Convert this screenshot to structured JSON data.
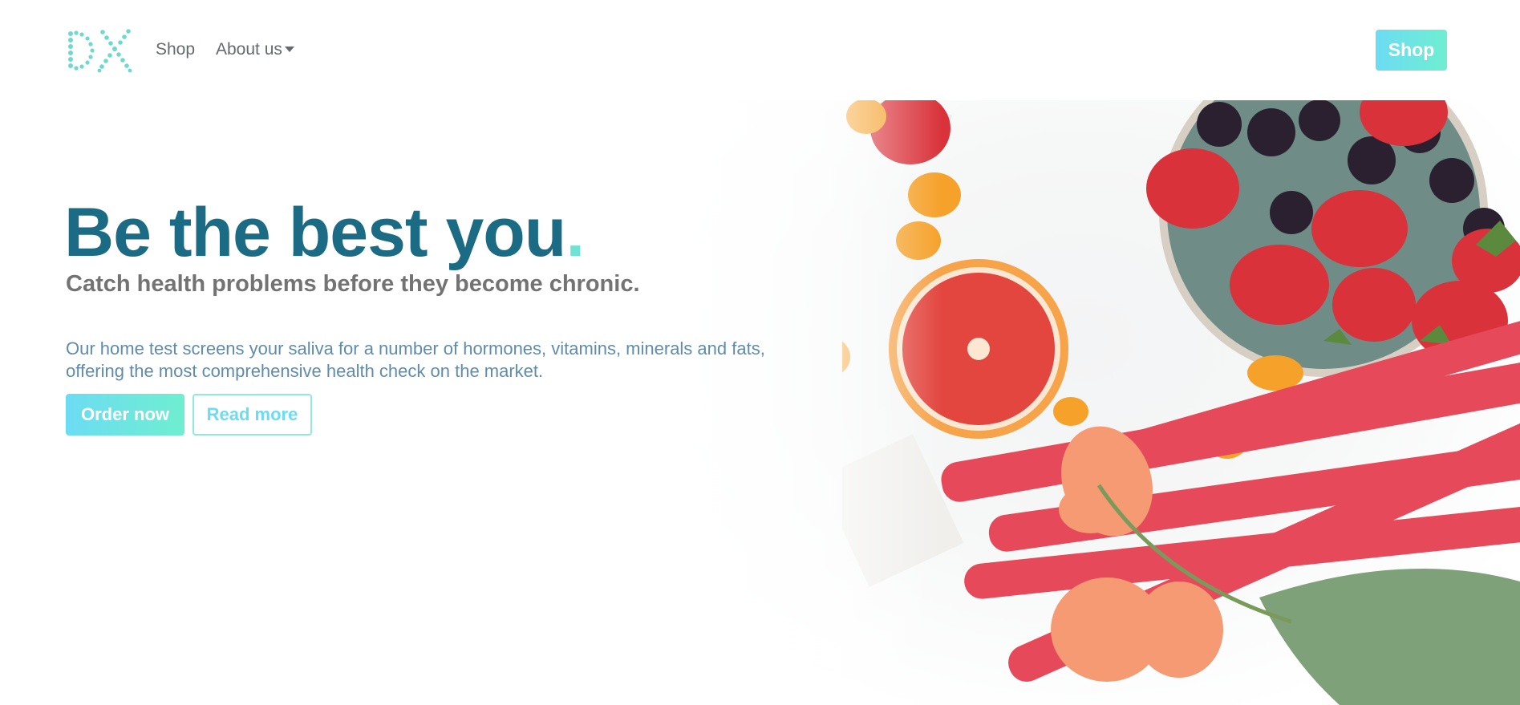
{
  "brand": {
    "logo_text": "DX",
    "logo_icon": "dx-dotted-logo-icon"
  },
  "nav": {
    "shop_label": "Shop",
    "about_label": "About us",
    "about_icon": "caret-down-icon",
    "shop_button_label": "Shop"
  },
  "hero": {
    "headline": "Be the best you",
    "headline_dot": ".",
    "subheadline": "Catch health problems before they become chronic.",
    "body": "Our home test screens your saliva for a number of hormones, vitamins, minerals and fats, offering the most comprehensive health check on the market.",
    "order_button": "Order now",
    "read_button": "Read more",
    "image_icon": "fruit-flatlay-image"
  },
  "colors": {
    "brand_dark": "#1c6b84",
    "accent_gradient_start": "#6cdcf3",
    "accent_gradient_end": "#6feed0",
    "subhead_gray": "#737373",
    "body_blue": "#5f8cac"
  }
}
